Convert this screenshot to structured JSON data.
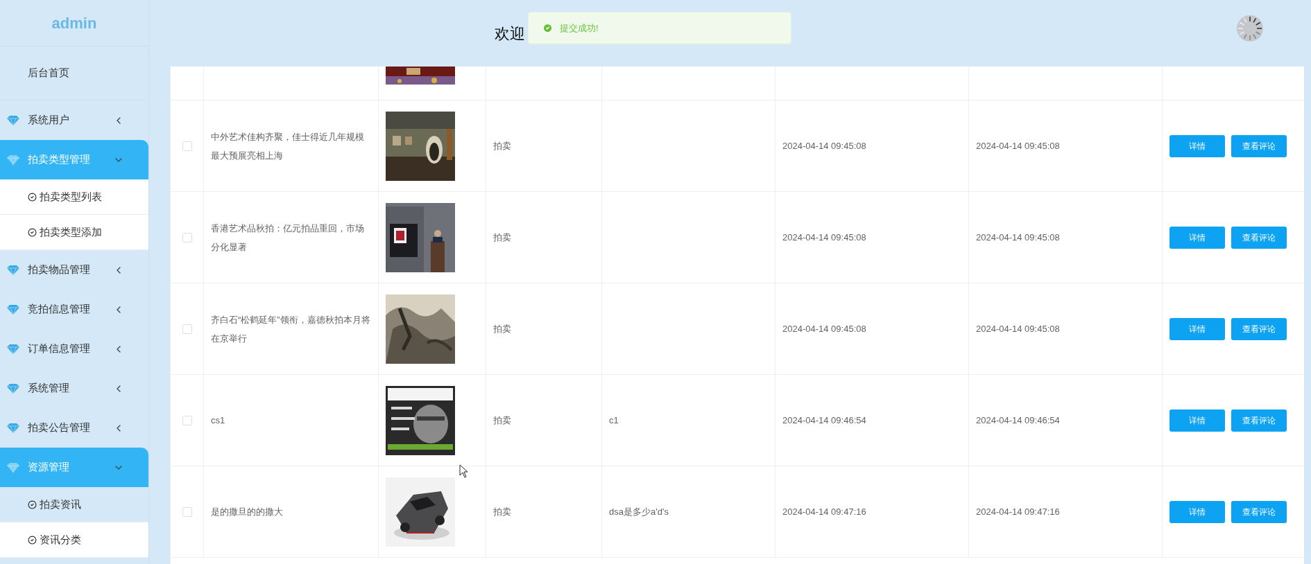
{
  "sidebar": {
    "brand": "admin",
    "items": [
      {
        "label": "后台首页",
        "kind": "link"
      },
      {
        "label": "系统用户",
        "kind": "group",
        "expanded": false
      },
      {
        "label": "拍卖类型管理",
        "kind": "group",
        "expanded": true,
        "children": [
          {
            "label": "拍卖类型列表",
            "selected": false
          },
          {
            "label": "拍卖类型添加",
            "selected": false
          }
        ]
      },
      {
        "label": "拍卖物品管理",
        "kind": "group",
        "expanded": false
      },
      {
        "label": "竞拍信息管理",
        "kind": "group",
        "expanded": false
      },
      {
        "label": "订单信息管理",
        "kind": "group",
        "expanded": false
      },
      {
        "label": "系统管理",
        "kind": "group",
        "expanded": false
      },
      {
        "label": "拍卖公告管理",
        "kind": "group",
        "expanded": false
      },
      {
        "label": "资源管理",
        "kind": "group",
        "expanded": true,
        "children": [
          {
            "label": "拍卖资讯",
            "selected": true
          },
          {
            "label": "资讯分类",
            "selected": false
          }
        ]
      }
    ]
  },
  "header": {
    "title": "欢迎"
  },
  "toast": {
    "message": "提交成功!",
    "kind": "success"
  },
  "table": {
    "rows": [
      {
        "checked": false,
        "title": "中外艺术佳构齐聚，佳士得近几年规模最大预展亮相上海",
        "type": "拍卖",
        "created": "2024-04-14 09:45:08",
        "updated": "2024-04-14 09:45:08",
        "actions": [
          "详情",
          "查看评论"
        ]
      },
      {
        "checked": false,
        "title": "香港艺术品秋拍：亿元拍品重回，市场分化显著",
        "type": "拍卖",
        "created": "2024-04-14 09:45:08",
        "updated": "2024-04-14 09:45:08",
        "actions": [
          "详情",
          "查看评论"
        ]
      },
      {
        "checked": false,
        "title": "齐白石“松鹤延年”领衔，嘉德秋拍本月将在京举行",
        "type": "拍卖",
        "created": "2024-04-14 09:45:08",
        "updated": "2024-04-14 09:45:08",
        "actions": [
          "详情",
          "查看评论"
        ]
      },
      {
        "checked": false,
        "title": "cs1",
        "type": "拍卖",
        "column_4": "c1",
        "created": "2024-04-14 09:46:54",
        "updated": "2024-04-14 09:46:54",
        "actions": [
          "详情",
          "查看评论"
        ]
      },
      {
        "checked": false,
        "title": "是的撒旦的的撒大",
        "type": "拍卖",
        "column_4": "dsa是多少a'd's",
        "created": "2024-04-14 09:47:16",
        "updated": "2024-04-14 09:47:16",
        "actions": [
          "详情",
          "查看评论"
        ]
      }
    ]
  }
}
